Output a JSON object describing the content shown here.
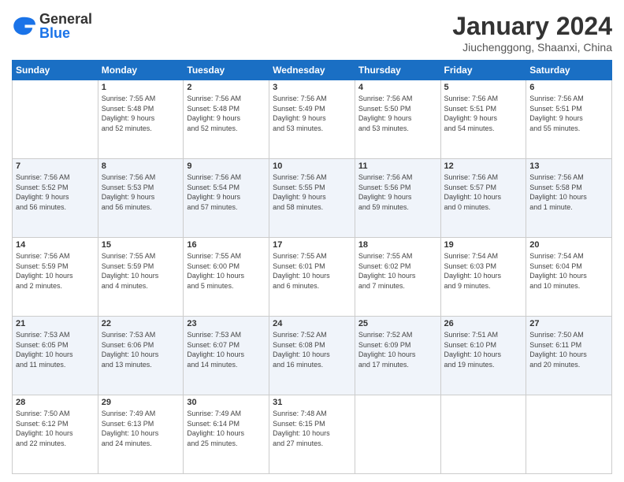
{
  "logo": {
    "general": "General",
    "blue": "Blue"
  },
  "title": {
    "month": "January 2024",
    "location": "Jiuchenggong, Shaanxi, China"
  },
  "headers": [
    "Sunday",
    "Monday",
    "Tuesday",
    "Wednesday",
    "Thursday",
    "Friday",
    "Saturday"
  ],
  "weeks": [
    {
      "days": [
        {
          "num": "",
          "info": "",
          "empty": true
        },
        {
          "num": "1",
          "info": "Sunrise: 7:55 AM\nSunset: 5:48 PM\nDaylight: 9 hours\nand 52 minutes."
        },
        {
          "num": "2",
          "info": "Sunrise: 7:56 AM\nSunset: 5:48 PM\nDaylight: 9 hours\nand 52 minutes."
        },
        {
          "num": "3",
          "info": "Sunrise: 7:56 AM\nSunset: 5:49 PM\nDaylight: 9 hours\nand 53 minutes."
        },
        {
          "num": "4",
          "info": "Sunrise: 7:56 AM\nSunset: 5:50 PM\nDaylight: 9 hours\nand 53 minutes."
        },
        {
          "num": "5",
          "info": "Sunrise: 7:56 AM\nSunset: 5:51 PM\nDaylight: 9 hours\nand 54 minutes."
        },
        {
          "num": "6",
          "info": "Sunrise: 7:56 AM\nSunset: 5:51 PM\nDaylight: 9 hours\nand 55 minutes."
        }
      ]
    },
    {
      "days": [
        {
          "num": "7",
          "info": "Sunrise: 7:56 AM\nSunset: 5:52 PM\nDaylight: 9 hours\nand 56 minutes."
        },
        {
          "num": "8",
          "info": "Sunrise: 7:56 AM\nSunset: 5:53 PM\nDaylight: 9 hours\nand 56 minutes."
        },
        {
          "num": "9",
          "info": "Sunrise: 7:56 AM\nSunset: 5:54 PM\nDaylight: 9 hours\nand 57 minutes."
        },
        {
          "num": "10",
          "info": "Sunrise: 7:56 AM\nSunset: 5:55 PM\nDaylight: 9 hours\nand 58 minutes."
        },
        {
          "num": "11",
          "info": "Sunrise: 7:56 AM\nSunset: 5:56 PM\nDaylight: 9 hours\nand 59 minutes."
        },
        {
          "num": "12",
          "info": "Sunrise: 7:56 AM\nSunset: 5:57 PM\nDaylight: 10 hours\nand 0 minutes."
        },
        {
          "num": "13",
          "info": "Sunrise: 7:56 AM\nSunset: 5:58 PM\nDaylight: 10 hours\nand 1 minute."
        }
      ]
    },
    {
      "days": [
        {
          "num": "14",
          "info": "Sunrise: 7:56 AM\nSunset: 5:59 PM\nDaylight: 10 hours\nand 2 minutes."
        },
        {
          "num": "15",
          "info": "Sunrise: 7:55 AM\nSunset: 5:59 PM\nDaylight: 10 hours\nand 4 minutes."
        },
        {
          "num": "16",
          "info": "Sunrise: 7:55 AM\nSunset: 6:00 PM\nDaylight: 10 hours\nand 5 minutes."
        },
        {
          "num": "17",
          "info": "Sunrise: 7:55 AM\nSunset: 6:01 PM\nDaylight: 10 hours\nand 6 minutes."
        },
        {
          "num": "18",
          "info": "Sunrise: 7:55 AM\nSunset: 6:02 PM\nDaylight: 10 hours\nand 7 minutes."
        },
        {
          "num": "19",
          "info": "Sunrise: 7:54 AM\nSunset: 6:03 PM\nDaylight: 10 hours\nand 9 minutes."
        },
        {
          "num": "20",
          "info": "Sunrise: 7:54 AM\nSunset: 6:04 PM\nDaylight: 10 hours\nand 10 minutes."
        }
      ]
    },
    {
      "days": [
        {
          "num": "21",
          "info": "Sunrise: 7:53 AM\nSunset: 6:05 PM\nDaylight: 10 hours\nand 11 minutes."
        },
        {
          "num": "22",
          "info": "Sunrise: 7:53 AM\nSunset: 6:06 PM\nDaylight: 10 hours\nand 13 minutes."
        },
        {
          "num": "23",
          "info": "Sunrise: 7:53 AM\nSunset: 6:07 PM\nDaylight: 10 hours\nand 14 minutes."
        },
        {
          "num": "24",
          "info": "Sunrise: 7:52 AM\nSunset: 6:08 PM\nDaylight: 10 hours\nand 16 minutes."
        },
        {
          "num": "25",
          "info": "Sunrise: 7:52 AM\nSunset: 6:09 PM\nDaylight: 10 hours\nand 17 minutes."
        },
        {
          "num": "26",
          "info": "Sunrise: 7:51 AM\nSunset: 6:10 PM\nDaylight: 10 hours\nand 19 minutes."
        },
        {
          "num": "27",
          "info": "Sunrise: 7:50 AM\nSunset: 6:11 PM\nDaylight: 10 hours\nand 20 minutes."
        }
      ]
    },
    {
      "days": [
        {
          "num": "28",
          "info": "Sunrise: 7:50 AM\nSunset: 6:12 PM\nDaylight: 10 hours\nand 22 minutes."
        },
        {
          "num": "29",
          "info": "Sunrise: 7:49 AM\nSunset: 6:13 PM\nDaylight: 10 hours\nand 24 minutes."
        },
        {
          "num": "30",
          "info": "Sunrise: 7:49 AM\nSunset: 6:14 PM\nDaylight: 10 hours\nand 25 minutes."
        },
        {
          "num": "31",
          "info": "Sunrise: 7:48 AM\nSunset: 6:15 PM\nDaylight: 10 hours\nand 27 minutes."
        },
        {
          "num": "",
          "info": "",
          "empty": true
        },
        {
          "num": "",
          "info": "",
          "empty": true
        },
        {
          "num": "",
          "info": "",
          "empty": true
        }
      ]
    }
  ]
}
